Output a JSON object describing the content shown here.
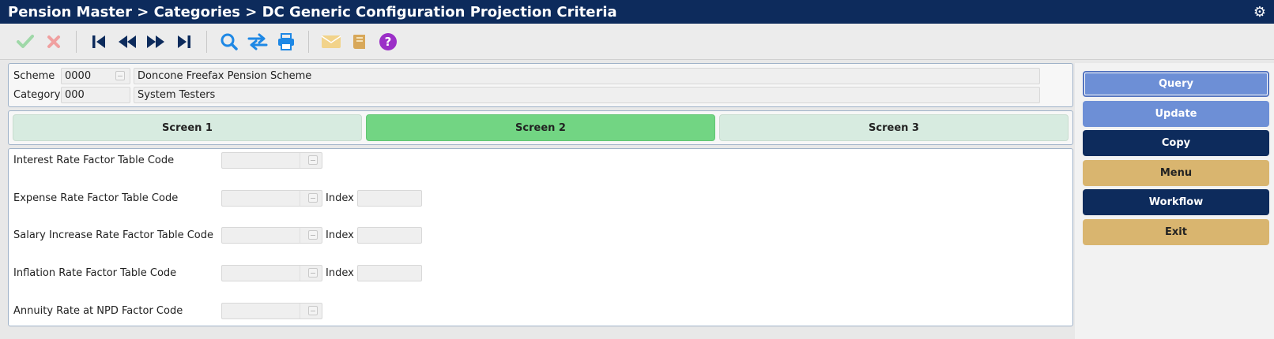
{
  "title": "Pension Master > Categories > DC Generic Configuration Projection Criteria",
  "toolbar": {
    "icons": [
      "check-icon",
      "close-x-icon",
      "first-record-icon",
      "previous-record-icon",
      "next-record-icon",
      "last-record-icon",
      "search-icon",
      "swap-icon",
      "print-icon",
      "mail-icon",
      "notebook-icon",
      "help-icon"
    ]
  },
  "header": {
    "scheme_label": "Scheme",
    "scheme_code": "0000",
    "scheme_name": "Doncone Freefax Pension Scheme",
    "category_label": "Category",
    "category_code": "000",
    "category_name": "System Testers"
  },
  "tabs": [
    {
      "label": "Screen 1",
      "active": false
    },
    {
      "label": "Screen 2",
      "active": true
    },
    {
      "label": "Screen 3",
      "active": false
    }
  ],
  "form": {
    "rows": [
      {
        "label": "Interest Rate Factor Table Code",
        "code": "",
        "has_index": false,
        "index": ""
      },
      {
        "label": "Expense Rate Factor Table Code",
        "code": "",
        "has_index": true,
        "index_label": "Index",
        "index": ""
      },
      {
        "label": "Salary Increase Rate Factor Table Code",
        "code": "",
        "has_index": true,
        "index_label": "Index",
        "index": ""
      },
      {
        "label": "Inflation Rate Factor Table Code",
        "code": "",
        "has_index": true,
        "index_label": "Index",
        "index": ""
      },
      {
        "label": "Annuity Rate at NPD Factor Code",
        "code": "",
        "has_index": false,
        "index": ""
      }
    ]
  },
  "sidebar": {
    "buttons": [
      {
        "label": "Query"
      },
      {
        "label": "Update"
      },
      {
        "label": "Copy"
      },
      {
        "label": "Menu"
      },
      {
        "label": "Workflow"
      },
      {
        "label": "Exit"
      }
    ]
  },
  "colors": {
    "titlebar": "#0d2b5c",
    "active_tab": "#72d583",
    "inactive_tab": "#d7ebe0",
    "primary_button": "#6d8fd6",
    "dark_button": "#0d2b5c",
    "tan_button": "#d9b56f"
  }
}
